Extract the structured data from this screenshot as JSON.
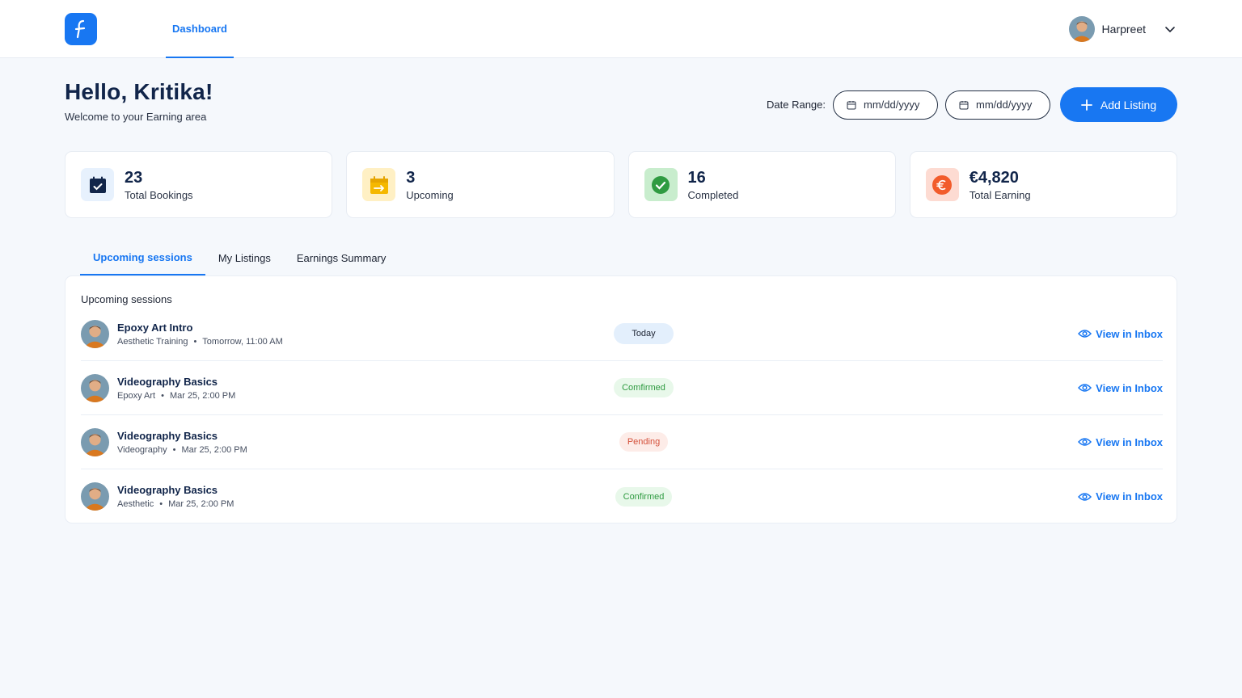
{
  "nav": {
    "tab": "Dashboard"
  },
  "user": {
    "name": "Harpreet"
  },
  "header": {
    "greeting": "Hello, Kritika!",
    "subtitle": "Welcome to your Earning area"
  },
  "date_range": {
    "label": "Date Range:",
    "from_placeholder": "mm/dd/yyyy",
    "to_placeholder": "mm/dd/yyyy"
  },
  "add_listing": {
    "label": "Add Listing"
  },
  "stats": [
    {
      "value": "23",
      "label": "Total Bookings",
      "icon": "calendar-check-icon",
      "color": "#11254a"
    },
    {
      "value": "3",
      "label": "Upcoming",
      "icon": "calendar-arrow-icon",
      "color": "#f5b800"
    },
    {
      "value": "16",
      "label": "Completed",
      "icon": "check-circle-icon",
      "color": "#2f9b41"
    },
    {
      "value": "€4,820",
      "label": "Total Earning",
      "icon": "euro-icon",
      "color": "#f25c2b"
    }
  ],
  "tabs": [
    "Upcoming sessions",
    "My Listings",
    "Earnings Summary"
  ],
  "sessions": {
    "title": "Upcoming sessions",
    "rows": [
      {
        "title": "Epoxy Art Intro",
        "category": "Aesthetic Training",
        "dot": "•",
        "time": "Tomorrow, 11:00 AM",
        "status": "Today",
        "action": "View in Inbox"
      },
      {
        "title": "Videography Basics",
        "category": "Epoxy Art",
        "dot": "•",
        "time": "Mar 25, 2:00 PM",
        "status": "Comfirmed",
        "action": "View in Inbox"
      },
      {
        "title": "Videography Basics",
        "category": "Videography",
        "dot": "•",
        "time": "Mar 25, 2:00 PM",
        "status": "Pending",
        "action": "View in Inbox"
      },
      {
        "title": "Videography Basics",
        "category": "Aesthetic",
        "dot": "•",
        "time": "Mar 25, 2:00 PM",
        "status": "Confirmed",
        "action": "View in Inbox"
      }
    ]
  }
}
